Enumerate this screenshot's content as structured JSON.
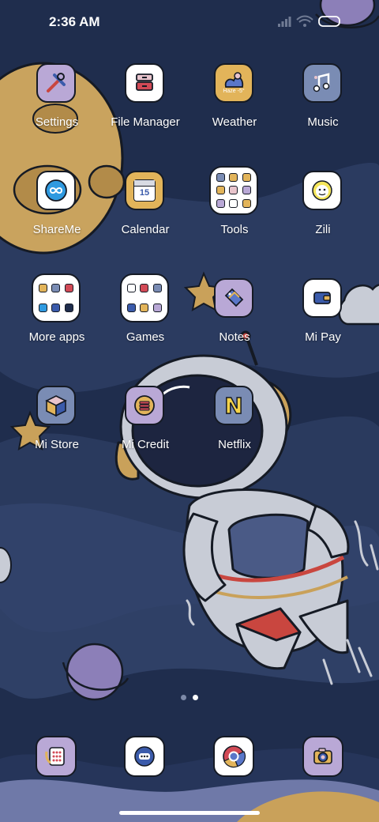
{
  "status_bar": {
    "time": "2:36 AM",
    "icons": [
      "signal-icon",
      "wifi-icon",
      "battery-icon"
    ]
  },
  "apps": [
    {
      "label": "Settings",
      "icon": "settings-tools-icon",
      "color": "#b9a8d6"
    },
    {
      "label": "File Manager",
      "icon": "file-cabinet-icon",
      "color": "#ffffff"
    },
    {
      "label": "Weather",
      "icon": "weather-icon",
      "color": "#e2b45a",
      "badge": "Haze -5°"
    },
    {
      "label": "Music",
      "icon": "music-note-icon",
      "color": "#7a8cb4"
    },
    {
      "label": "ShareMe",
      "icon": "infinity-share-icon",
      "color": "#ffffff"
    },
    {
      "label": "Calendar",
      "icon": "calendar-icon",
      "color": "#e2b45a",
      "badge": "15"
    },
    {
      "label": "Tools",
      "icon": "tools-folder-icon",
      "color": "#ffffff"
    },
    {
      "label": "Zili",
      "icon": "smiley-face-icon",
      "color": "#ffffff"
    },
    {
      "label": "More apps",
      "icon": "apps-folder-icon",
      "color": "#ffffff"
    },
    {
      "label": "Games",
      "icon": "games-folder-icon",
      "color": "#ffffff"
    },
    {
      "label": "Notes",
      "icon": "tag-notes-icon",
      "color": "#b9a8d6"
    },
    {
      "label": "Mi Pay",
      "icon": "wallet-icon",
      "color": "#ffffff"
    },
    {
      "label": "Mi Store",
      "icon": "cube-store-icon",
      "color": "#7a8cb4"
    },
    {
      "label": "Mi Credit",
      "icon": "coin-stack-icon",
      "color": "#b9a8d6"
    },
    {
      "label": "Netflix",
      "icon": "netflix-n-icon",
      "color": "#7a8cb4",
      "letter": "N"
    }
  ],
  "dock": [
    {
      "icon": "phone-dialer-icon",
      "color": "#b9a8d6"
    },
    {
      "icon": "messages-icon",
      "color": "#ffffff"
    },
    {
      "icon": "chrome-browser-icon",
      "color": "#ffffff"
    },
    {
      "icon": "camera-icon",
      "color": "#b9a8d6"
    }
  ],
  "pages": {
    "count": 2,
    "current": 2
  },
  "colors": {
    "wallpaper_bg": "#1f2d4d",
    "accent_yellow": "#e2b45a",
    "accent_purple": "#b9a8d6",
    "accent_blue": "#7a8cb4"
  }
}
